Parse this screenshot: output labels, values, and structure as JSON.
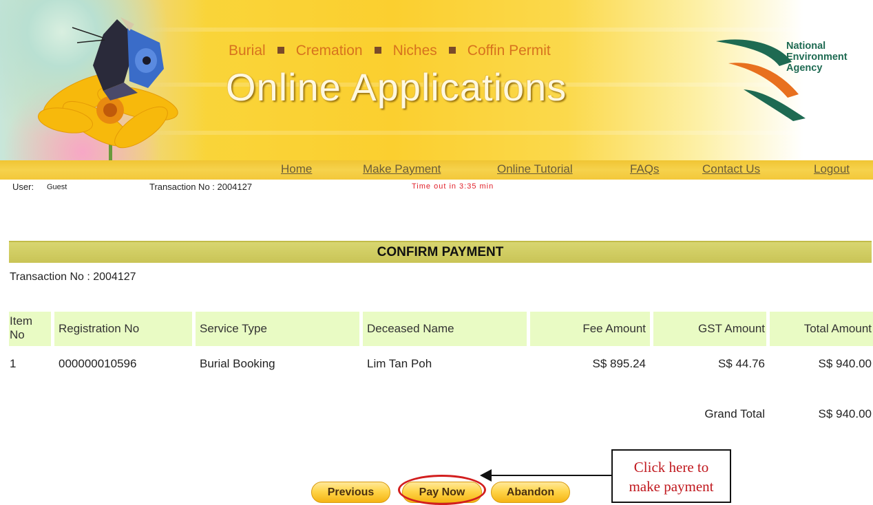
{
  "header": {
    "categories": [
      "Burial",
      "Cremation",
      "Niches",
      "Coffin Permit"
    ],
    "title": "Online Applications",
    "agency_logo": "nea-logo",
    "agency_name_lines": [
      "National",
      "Environment",
      "Agency"
    ]
  },
  "nav": {
    "items": [
      "Home",
      "Make Payment",
      "Online Tutorial",
      "FAQs",
      "Contact Us",
      "Logout"
    ]
  },
  "session": {
    "user_label": "User:",
    "user_value": "Guest",
    "transaction_label": "Transaction No : 2004127",
    "timeout": "Time out in 3:35 min"
  },
  "confirm": {
    "heading": "CONFIRM PAYMENT",
    "transaction": "Transaction No : 2004127",
    "columns": {
      "item_no_line1": "Item",
      "item_no_line2": "No",
      "registration_no": "Registration No",
      "service_type": "Service Type",
      "deceased_name": "Deceased Name",
      "fee_amount": "Fee Amount",
      "gst_amount": "GST Amount",
      "total_amount": "Total Amount"
    },
    "rows": [
      {
        "item_no": "1",
        "registration_no": "000000010596",
        "service_type": "Burial Booking",
        "deceased_name": "Lim Tan Poh",
        "fee_amount": "S$ 895.24",
        "gst_amount": "S$ 44.76",
        "total_amount": "S$ 940.00"
      }
    ],
    "grand_total_label": "Grand Total",
    "grand_total_value": "S$ 940.00"
  },
  "buttons": {
    "previous": "Previous",
    "pay_now": "Pay Now",
    "abandon": "Abandon"
  },
  "callout": {
    "line1": "Click here to",
    "line2": "make payment"
  },
  "colors": {
    "banner_yellow": "#fbcf2f",
    "nav_link": "#6a5c38",
    "section_bar": "#c9c456",
    "table_header_bg": "#e9fbc4",
    "timeout_red": "#e0202a",
    "highlight_red": "#d21e1e",
    "nea_green": "#1e6a52",
    "nea_orange": "#e8701e"
  }
}
